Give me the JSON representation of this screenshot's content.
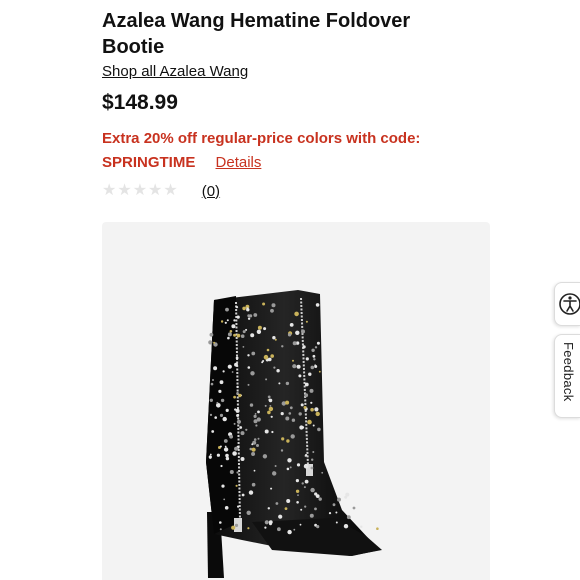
{
  "product": {
    "title": "Azalea Wang Hematine Foldover Bootie",
    "brand_link": "Shop all Azalea Wang",
    "price": "$148.99"
  },
  "promo": {
    "text": "Extra 20% off regular-price colors with code: SPRINGTIME",
    "details_label": "Details",
    "color": "#c8321f"
  },
  "rating": {
    "stars_filled": 0,
    "stars_total": 5,
    "review_count_label": "(0)"
  },
  "side_tabs": {
    "accessibility_icon": "accessibility-icon",
    "feedback_label": "Feedback"
  },
  "image": {
    "subject_icon": "studded-boot-image"
  }
}
